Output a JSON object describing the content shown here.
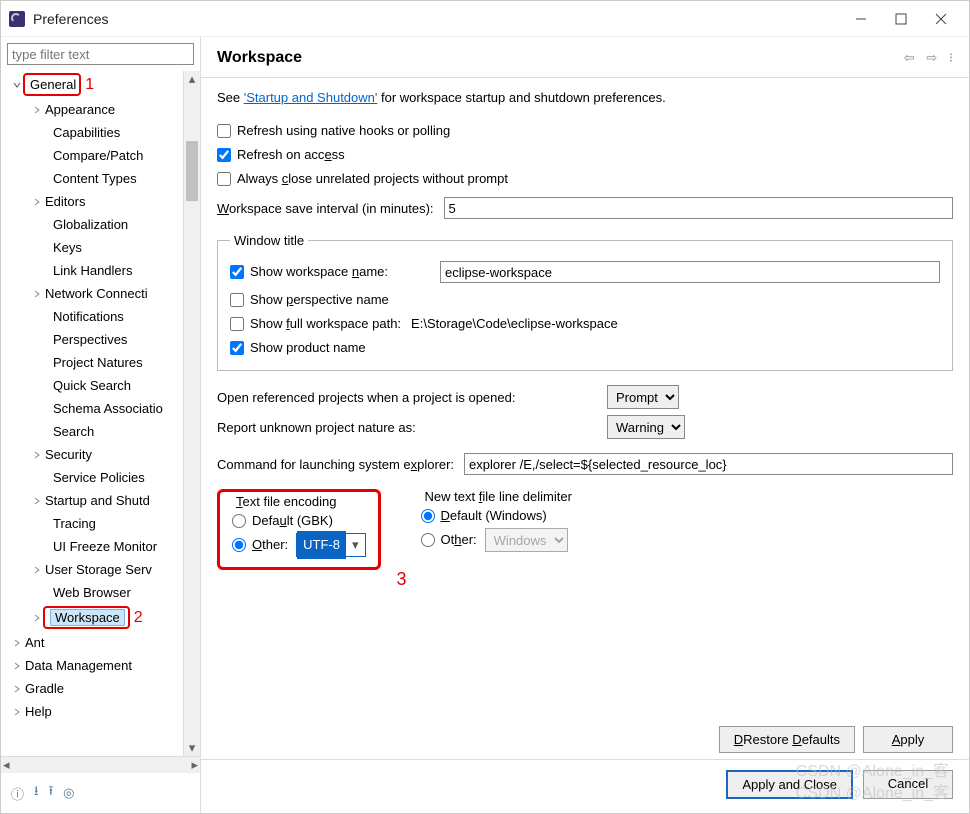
{
  "window": {
    "title": "Preferences"
  },
  "filter": {
    "placeholder": "type filter text"
  },
  "tree": {
    "general": "General",
    "items_l1": {
      "appearance": "Appearance",
      "capabilities": "Capabilities",
      "compare_patch": "Compare/Patch",
      "content_types": "Content Types",
      "editors": "Editors",
      "globalization": "Globalization",
      "keys": "Keys",
      "link_handlers": "Link Handlers",
      "network": "Network Connecti",
      "notifications": "Notifications",
      "perspectives": "Perspectives",
      "project_natures": "Project Natures",
      "quick_search": "Quick Search",
      "schema_assoc": "Schema Associatio",
      "search": "Search",
      "security": "Security",
      "service_policies": "Service Policies",
      "startup": "Startup and Shutd",
      "tracing": "Tracing",
      "ui_freeze": "UI Freeze Monitor",
      "user_storage": "User Storage Serv",
      "web_browser": "Web Browser",
      "workspace": "Workspace"
    },
    "roots": {
      "ant": "Ant",
      "data_mgmt": "Data Management",
      "gradle": "Gradle",
      "help": "Help"
    }
  },
  "annotations": {
    "a1": "1",
    "a2": "2",
    "a3": "3"
  },
  "page": {
    "heading": "Workspace",
    "see_prefix": "See ",
    "see_link": "'Startup and Shutdown'",
    "see_suffix": " for workspace startup and shutdown preferences.",
    "cb_refresh_native": "Refresh using native hooks or polling",
    "cb_refresh_access_pre": "Refresh on acc",
    "cb_refresh_access_u": "e",
    "cb_refresh_access_post": "ss",
    "cb_close_unrelated_pre": "Always ",
    "cb_close_unrelated_u": "c",
    "cb_close_unrelated_post": "lose unrelated projects without prompt",
    "save_interval_label_u": "W",
    "save_interval_label_post": "orkspace save interval (in minutes):",
    "save_interval_value": "5",
    "fs_window_title": "Window title",
    "cb_show_ws_name_pre": "Show workspace ",
    "cb_show_ws_name_u": "n",
    "cb_show_ws_name_post": "ame:",
    "ws_name_value": "eclipse-workspace",
    "cb_show_persp_pre": "Show ",
    "cb_show_persp_u": "p",
    "cb_show_persp_post": "erspective name",
    "cb_show_full_path_pre": "Show ",
    "cb_show_full_path_u": "f",
    "cb_show_full_path_post": "ull workspace path:",
    "ws_path_value": "E:\\Storage\\Code\\eclipse-workspace",
    "cb_show_product": "Show product name",
    "open_ref_label": "Open referenced projects when a project is opened:",
    "open_ref_value": "Prompt",
    "report_nature_label": "Report unknown project nature as:",
    "report_nature_value": "Warning",
    "explorer_label_pre": "Command for launching system e",
    "explorer_label_u": "x",
    "explorer_label_post": "plorer:",
    "explorer_value": "explorer /E,/select=${selected_resource_loc}",
    "encoding_legend_u": "T",
    "encoding_legend_post": "ext file encoding",
    "encoding_default_pre": "Defa",
    "encoding_default_u": "u",
    "encoding_default_post": "lt (GBK)",
    "encoding_other_u": "O",
    "encoding_other_post": "ther:",
    "encoding_other_value": "UTF-8",
    "delim_legend_pre": "New text ",
    "delim_legend_u": "f",
    "delim_legend_post": "ile line delimiter",
    "delim_default_u": "D",
    "delim_default_post": "efault (Windows)",
    "delim_other_pre": "Ot",
    "delim_other_u": "h",
    "delim_other_post": "er:",
    "delim_other_value": "Windows"
  },
  "buttons": {
    "restore": "Restore Defaults",
    "apply": "Apply",
    "apply_close": "Apply and Close",
    "cancel": "Cancel"
  },
  "watermark1": "CSDN @Alone_in_客",
  "watermark2": "CSDN @Alone_in_客"
}
